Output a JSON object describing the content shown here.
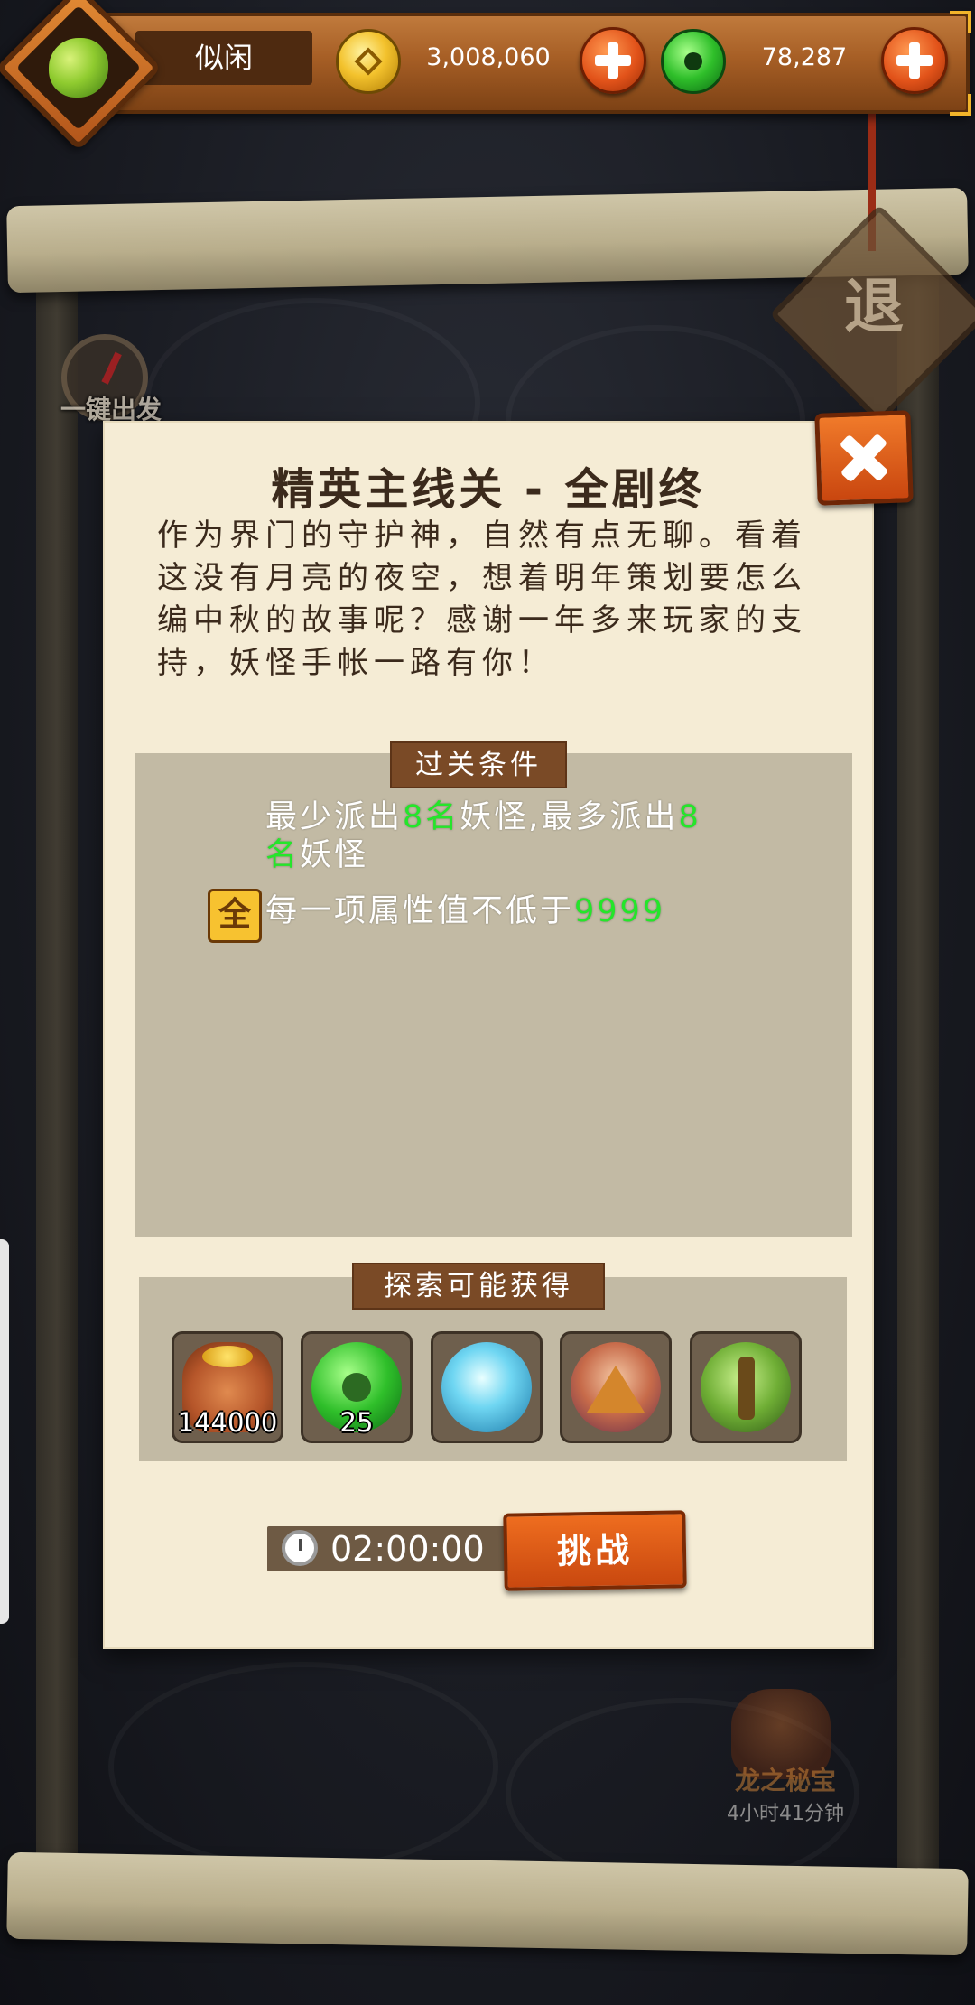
{
  "header": {
    "status": "似闲",
    "gold_amount": "3,008,060",
    "jade_amount": "78,287"
  },
  "background": {
    "exit_label": "退",
    "one_click_label": "一键出发",
    "dragon_treasure_label": "龙之秘宝",
    "dragon_treasure_timer": "4小时41分钟"
  },
  "modal": {
    "title": "精英主线关 - 全剧终",
    "description": "作为界门的守护神，自然有点无聊。看着这没有月亮的夜空，想着明年策划要怎么编中秋的故事呢？感谢一年多来玩家的支持，妖怪手帐一路有你！",
    "conditions_tag": "过关条件",
    "condition_1": {
      "a": "最少派出",
      "b": "8名",
      "c": "妖怪,最多派出",
      "d": "8",
      "e": "名",
      "f": "妖怪"
    },
    "condition_2": {
      "badge": "全",
      "a": "每一项属性值不低于",
      "b": "9999"
    },
    "rewards_tag": "探索可能获得",
    "rewards": [
      {
        "icon": "gold-bag-icon",
        "count": "144000"
      },
      {
        "icon": "jade-icon",
        "count": "25"
      },
      {
        "icon": "ice-crystal-icon",
        "count": ""
      },
      {
        "icon": "mountain-icon",
        "count": ""
      },
      {
        "icon": "vine-icon",
        "count": ""
      }
    ],
    "timer": "02:00:00",
    "challenge_label": "挑战"
  }
}
